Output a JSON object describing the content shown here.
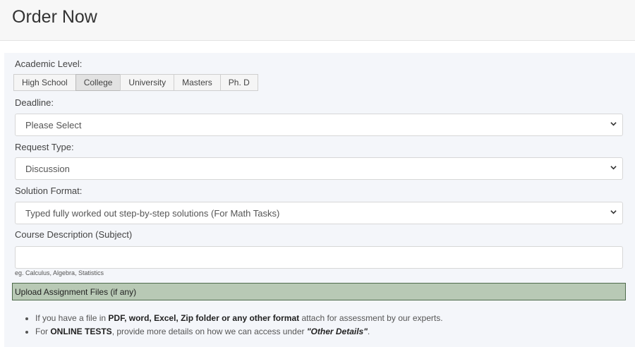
{
  "page": {
    "title": "Order Now"
  },
  "form": {
    "academic_level": {
      "label": "Academic Level:",
      "options": [
        "High School",
        "College",
        "University",
        "Masters",
        "Ph. D"
      ],
      "selected": "College"
    },
    "deadline": {
      "label": "Deadline:",
      "value": "Please Select"
    },
    "request_type": {
      "label": "Request Type:",
      "value": "Discussion"
    },
    "solution_format": {
      "label": "Solution Format:",
      "value": "Typed fully worked out step-by-step solutions (For Math Tasks)"
    },
    "course_description": {
      "label": "Course Description (Subject)",
      "value": "",
      "hint": "eg. Calculus, Algebra, Statistics"
    },
    "upload": {
      "label": "Upload Assignment Files (if any)"
    },
    "notes": {
      "n1_a": "If you have a file in ",
      "n1_b": "PDF, word, Excel, Zip folder or any other format",
      "n1_c": " attach for assessment by our experts.",
      "n2_a": "For ",
      "n2_b": "ONLINE TESTS",
      "n2_c": ", provide more details on how we can access under ",
      "n2_d": "\"Other Details\"",
      "n2_e": "."
    }
  },
  "icons": {
    "select_arrow": "chevron-down-icon"
  },
  "colors": {
    "upload_bar_bg": "#b8c9b5",
    "upload_bar_border": "#4f6b4c",
    "panel_bg": "#f4f6fa"
  }
}
